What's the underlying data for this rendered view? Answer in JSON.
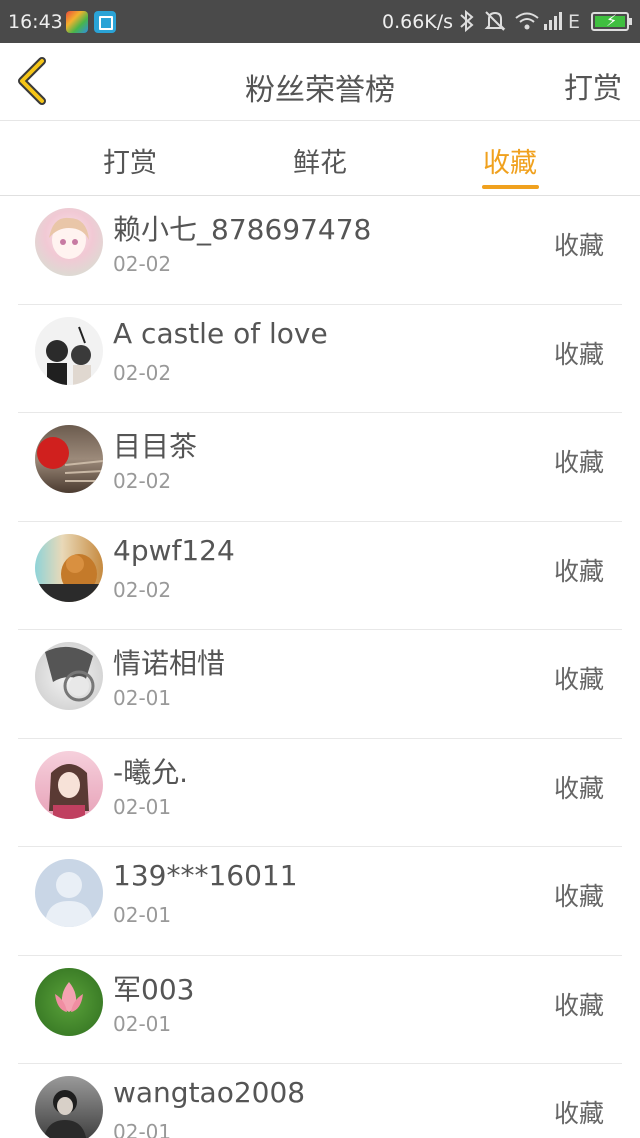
{
  "status_bar": {
    "time": "16:43",
    "network_speed": "0.66K/s",
    "network_type": "E",
    "icons": [
      "app-gradient-icon",
      "crop-app-icon",
      "bluetooth-icon",
      "mute-icon",
      "wifi-icon",
      "signal-icon",
      "battery-charging-icon"
    ]
  },
  "header": {
    "title": "粉丝荣誉榜",
    "right_action": "打赏",
    "back_icon": "chevron-left-icon",
    "accent_color": "#f0a11e"
  },
  "tabs": [
    {
      "label": "打赏",
      "active": false
    },
    {
      "label": "鲜花",
      "active": false
    },
    {
      "label": "收藏",
      "active": true
    }
  ],
  "fans": [
    {
      "name": "赖小七_878697478",
      "date": "02-02",
      "action": "收藏"
    },
    {
      "name": "A castle of love",
      "date": "02-02",
      "action": "收藏"
    },
    {
      "name": "目目茶",
      "date": "02-02",
      "action": "收藏"
    },
    {
      "name": "4pwf124",
      "date": "02-02",
      "action": "收藏"
    },
    {
      "name": "情诺相惜",
      "date": "02-01",
      "action": "收藏"
    },
    {
      "name": "-曦允.",
      "date": "02-01",
      "action": "收藏"
    },
    {
      "name": "139***16011",
      "date": "02-01",
      "action": "收藏"
    },
    {
      "name": "军003",
      "date": "02-01",
      "action": "收藏"
    },
    {
      "name": "wangtao2008",
      "date": "02-01",
      "action": "收藏"
    }
  ]
}
